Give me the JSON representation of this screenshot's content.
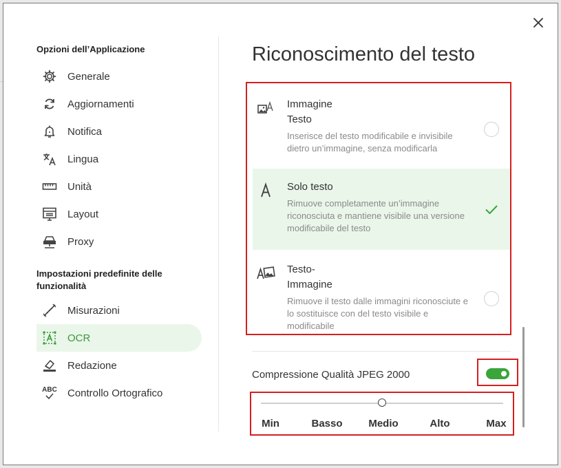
{
  "sidebar": {
    "section_app": "Opzioni dell’Applicazione",
    "items_app": [
      {
        "label": "Generale",
        "icon": "gear-icon"
      },
      {
        "label": "Aggiornamenti",
        "icon": "refresh-icon"
      },
      {
        "label": "Notifica",
        "icon": "bell-icon"
      },
      {
        "label": "Lingua",
        "icon": "translate-icon"
      },
      {
        "label": "Unità",
        "icon": "ruler-icon"
      },
      {
        "label": "Layout",
        "icon": "layout-icon"
      },
      {
        "label": "Proxy",
        "icon": "network-icon"
      }
    ],
    "section_features": "Impostazioni predefinite delle funzionalità",
    "items_features": [
      {
        "label": "Misurazioni",
        "icon": "measure-icon"
      },
      {
        "label": "OCR",
        "icon": "ocr-icon",
        "active": true
      },
      {
        "label": "Redazione",
        "icon": "eraser-icon"
      },
      {
        "label": "Controllo Ortografico",
        "icon": "spellcheck-icon",
        "icon_text": "ABC"
      }
    ]
  },
  "main": {
    "title": "Riconoscimento del testo",
    "options": [
      {
        "title_line1": "Immagine",
        "title_line2": "Testo",
        "description": "Inserisce del testo modificabile e invisibile dietro un’immagine, senza modificarla",
        "selected": false
      },
      {
        "title_line1": "Solo testo",
        "description": "Rimuove completamente un’immagine riconosciuta e mantiene visibile una versione modificabile del testo",
        "selected": true
      },
      {
        "title_line1": "Testo-",
        "title_line2": "Immagine",
        "description": "Rimuove il testo dalle immagini riconosciute e lo sostituisce con del testo visibile e modificabile",
        "selected": false
      }
    ],
    "jpeg_label": "Compressione Qualità JPEG 2000",
    "jpeg_enabled": true,
    "slider": {
      "labels": [
        "Min",
        "Basso",
        "Medio",
        "Alto",
        "Max"
      ],
      "selected": "Medio",
      "value_fraction": 0.5
    }
  },
  "colors": {
    "accent": "#3aa53a",
    "selected_bg": "#eaf6ea",
    "highlight_border": "#d61e1e"
  }
}
